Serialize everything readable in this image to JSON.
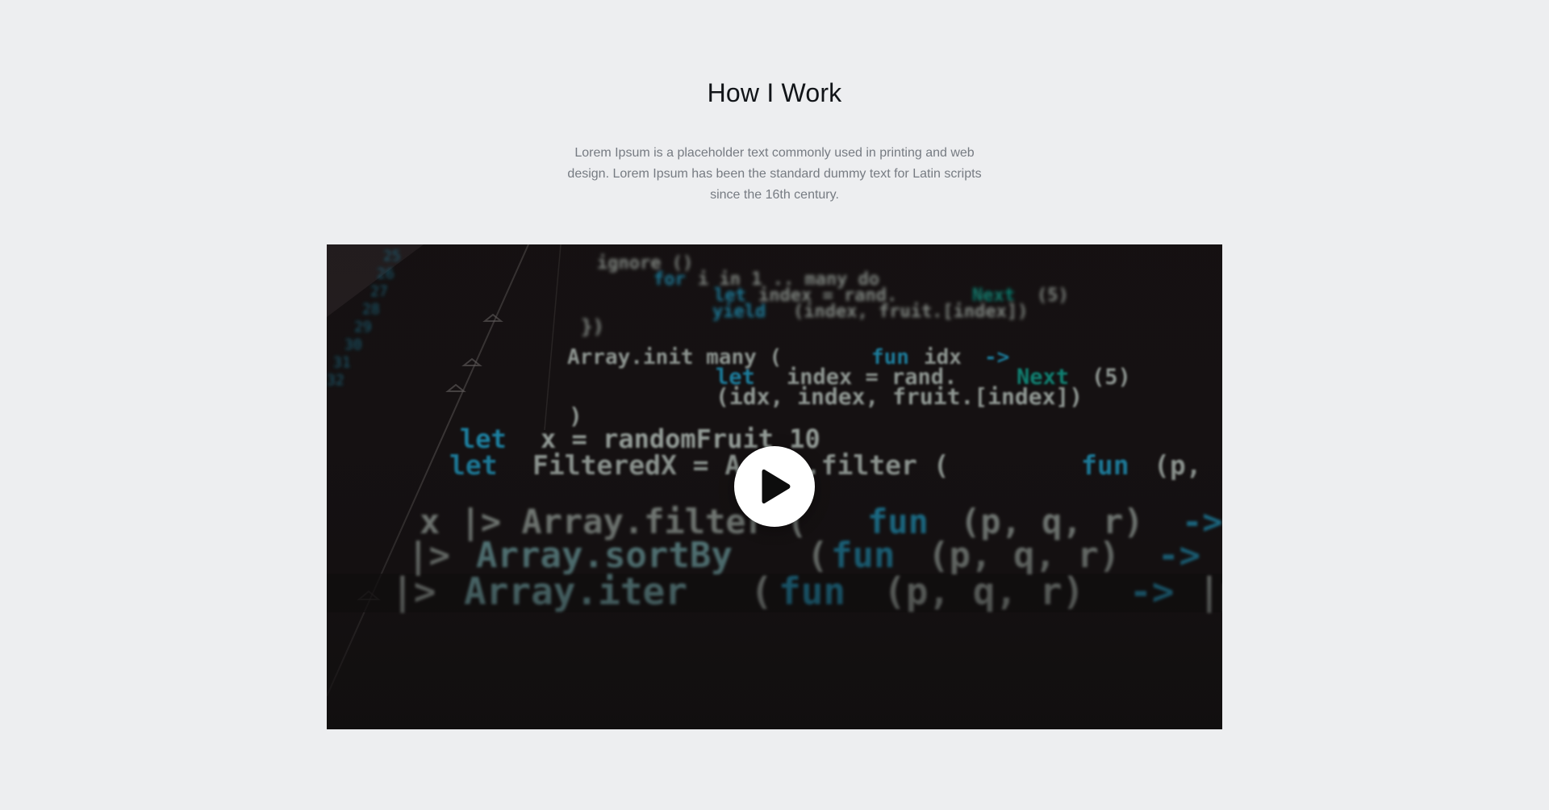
{
  "section": {
    "title": "How I Work",
    "description": "Lorem Ipsum is a placeholder text commonly used in printing and web design. Lorem Ipsum has been the standard dummy text for Latin scripts since the 16th century."
  },
  "video": {
    "play_icon": "play-icon",
    "background_color": "#141111",
    "code_lines": [
      "ignore ()",
      "for i in 1 .. many do",
      "let index = rand.Next(5)",
      "yield (index, fruit.[index])",
      "})",
      "Array.init many (fun idx ->",
      "let index = rand.Next(5)",
      "(idx, index, fruit.[index])",
      ")",
      "let x = randomFruit 10",
      "let FilteredX = Array.filter (fun (p,",
      "x |> Array.filter (fun (p, q, r) ->",
      "|> Array.sortBy (fun (p, q, r) ->",
      "|> Array.iter (fun (p, q, r) ->|p"
    ]
  },
  "colors": {
    "page_bg": "#edeef0",
    "title": "#111418",
    "description": "#767b82",
    "code_text": "#9aa39e",
    "code_keyword": "#1f86a8",
    "code_highlight": "#0e8a7a"
  }
}
